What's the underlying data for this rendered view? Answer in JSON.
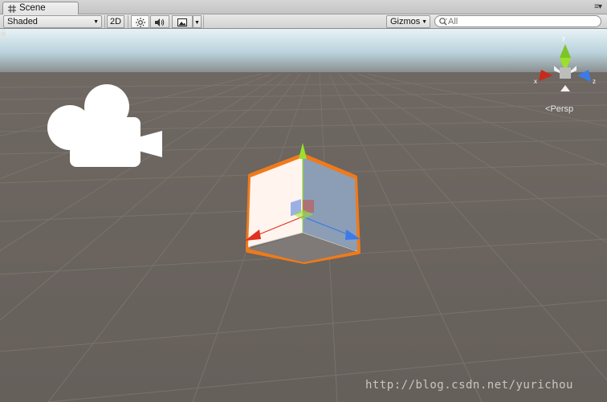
{
  "tab": {
    "title": "Scene",
    "menu_glyph": "≡▾"
  },
  "toolbar": {
    "shading_mode": "Shaded",
    "mode_2d": "2D",
    "lighting_icon": "sun-icon",
    "audio_icon": "speaker-icon",
    "effects_icon": "image-icon",
    "gizmos_label": "Gizmos",
    "search_placeholder": "All"
  },
  "viewport": {
    "orientation_gizmo": {
      "x_label": "x",
      "y_label": "y",
      "z_label": "z"
    },
    "projection_label": "Persp",
    "watermark": "http://blog.csdn.net/yurichou"
  },
  "colors": {
    "x_axis": "#e0301e",
    "y_axis": "#9be02a",
    "z_axis": "#3b7be8",
    "selection_outline": "#f07a1a",
    "sky": "#cfe5ef",
    "ground": "#6b6560"
  }
}
